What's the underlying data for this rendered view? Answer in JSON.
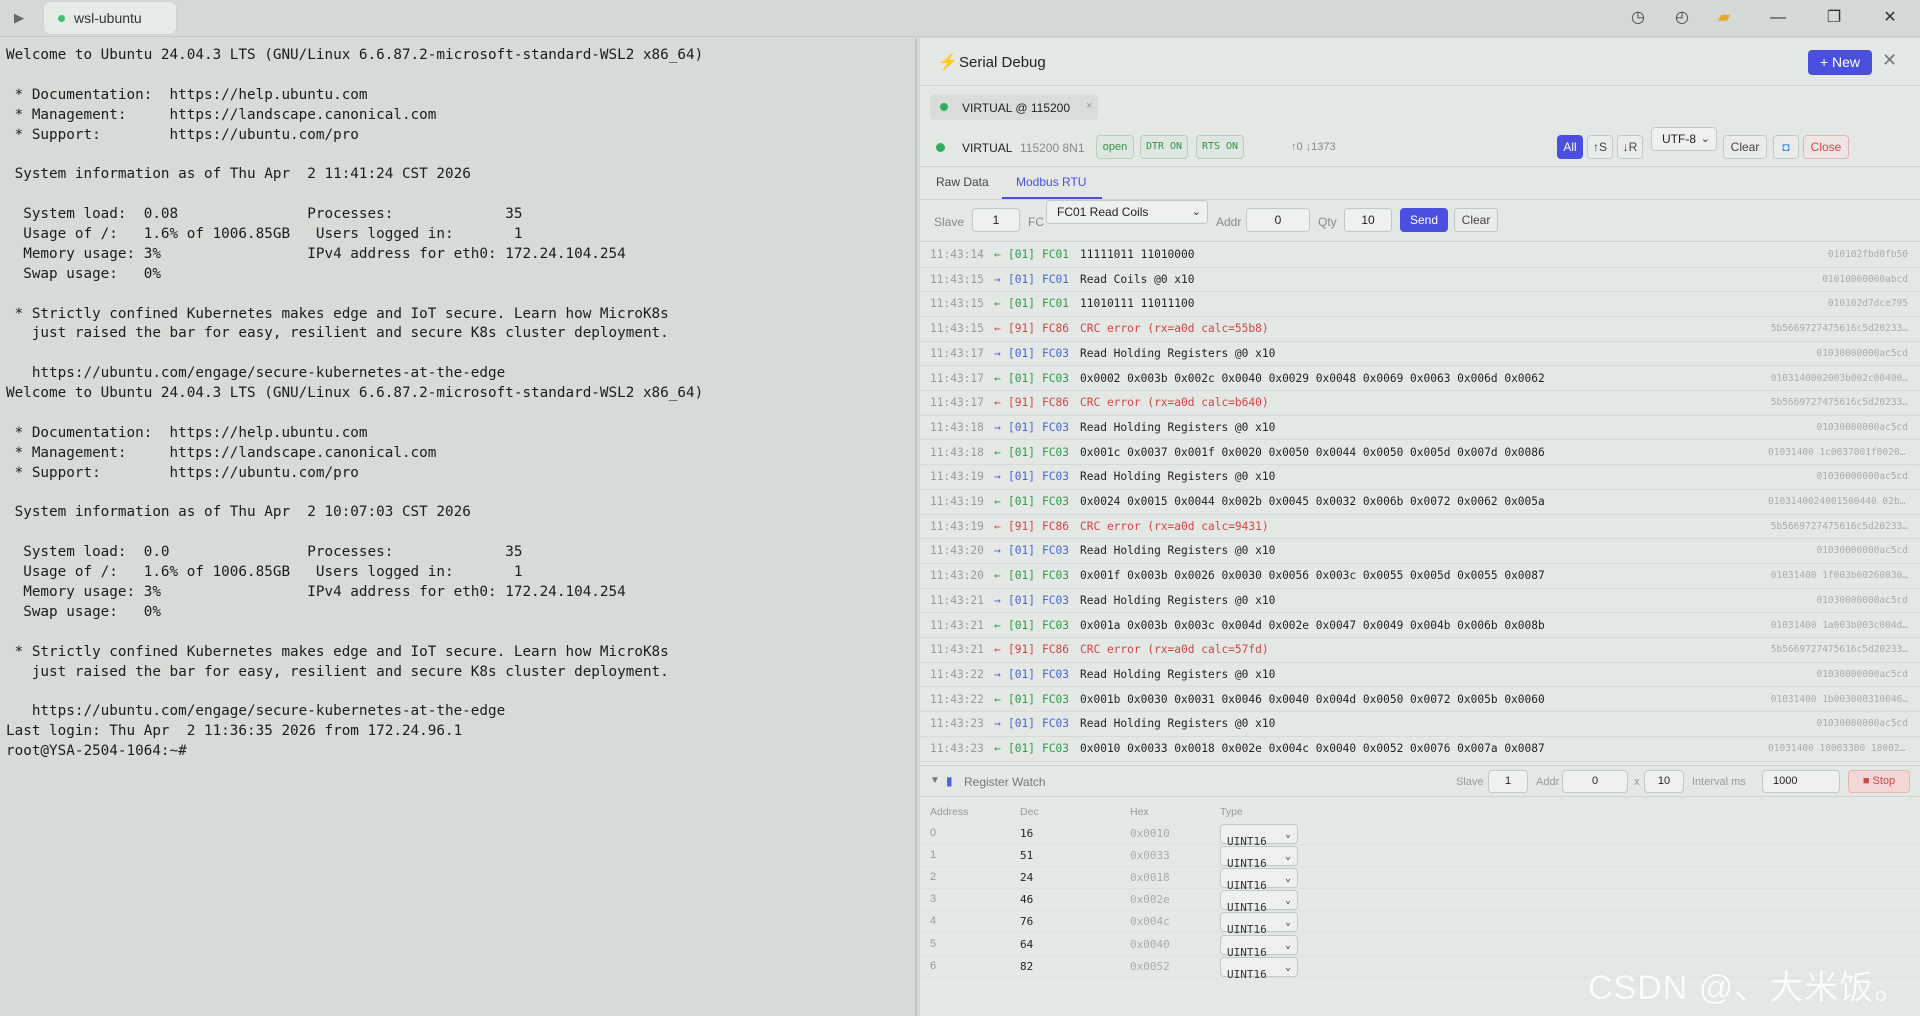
{
  "titlebar": {
    "tab_label": "wsl-ubuntu",
    "icons": [
      "play-icon",
      "history-icon",
      "clock-icon",
      "folder-icon",
      "minimize-icon",
      "restore-icon",
      "close-icon"
    ]
  },
  "terminal": {
    "lines": [
      "Welcome to Ubuntu 24.04.3 LTS (GNU/Linux 6.6.87.2-microsoft-standard-WSL2 x86_64)",
      "",
      " * Documentation:  https://help.ubuntu.com",
      " * Management:     https://landscape.canonical.com",
      " * Support:        https://ubuntu.com/pro",
      "",
      " System information as of Thu Apr  2 11:41:24 CST 2026",
      "",
      "  System load:  0.08               Processes:             35",
      "  Usage of /:   1.6% of 1006.85GB   Users logged in:       1",
      "  Memory usage: 3%                 IPv4 address for eth0: 172.24.104.254",
      "  Swap usage:   0%",
      "",
      " * Strictly confined Kubernetes makes edge and IoT secure. Learn how MicroK8s",
      "   just raised the bar for easy, resilient and secure K8s cluster deployment.",
      "",
      "   https://ubuntu.com/engage/secure-kubernetes-at-the-edge",
      "Welcome to Ubuntu 24.04.3 LTS (GNU/Linux 6.6.87.2-microsoft-standard-WSL2 x86_64)",
      "",
      " * Documentation:  https://help.ubuntu.com",
      " * Management:     https://landscape.canonical.com",
      " * Support:        https://ubuntu.com/pro",
      "",
      " System information as of Thu Apr  2 10:07:03 CST 2026",
      "",
      "  System load:  0.0                Processes:             35",
      "  Usage of /:   1.6% of 1006.85GB   Users logged in:       1",
      "  Memory usage: 3%                 IPv4 address for eth0: 172.24.104.254",
      "  Swap usage:   0%",
      "",
      " * Strictly confined Kubernetes makes edge and IoT secure. Learn how MicroK8s",
      "   just raised the bar for easy, resilient and secure K8s cluster deployment.",
      "",
      "   https://ubuntu.com/engage/secure-kubernetes-at-the-edge",
      "Last login: Thu Apr  2 11:36:35 2026 from 172.24.96.1",
      "root@YSA-2504-1064:~#"
    ]
  },
  "panel": {
    "title": "Serial Debug",
    "new_label": "+ New",
    "chip_label": "VIRTUAL @ 115200",
    "chip_close": "×",
    "status": {
      "name": "VIRTUAL",
      "baud": "115200 8N1",
      "open": "open",
      "dtr": "DTR ON",
      "rts": "RTS ON",
      "counts": "↑0 ↓1373",
      "all": "All",
      "tx_filter": "↑S",
      "rx_filter": "↓R",
      "encoding": "UTF-8",
      "clear": "Clear",
      "close": "Close"
    },
    "tabs": {
      "raw": "Raw Data",
      "modbus": "Modbus RTU"
    },
    "controls": {
      "slave_label": "Slave",
      "slave": "1",
      "fc_label": "FC",
      "fc": "FC01 Read Coils",
      "addr_label": "Addr",
      "addr": "0",
      "qty_label": "Qty",
      "qty": "10",
      "send": "Send",
      "clear": "Clear"
    },
    "log": [
      {
        "time": "11:43:14",
        "dir": "←",
        "type": "rx",
        "unit": "[01]",
        "fc": "FC01",
        "msg": "11111011 11010000",
        "raw": "010102fbd0fb50"
      },
      {
        "time": "11:43:15",
        "dir": "→",
        "type": "tx",
        "unit": "[01]",
        "fc": "FC01",
        "msg": "Read Coils @0 x10",
        "raw": "01010000000abcd"
      },
      {
        "time": "11:43:15",
        "dir": "←",
        "type": "rx",
        "unit": "[01]",
        "fc": "FC01",
        "msg": "11010111 11011100",
        "raw": "010102d7dce795"
      },
      {
        "time": "11:43:15",
        "dir": "←",
        "type": "er",
        "unit": "[91]",
        "fc": "FC86",
        "msg": "CRC error (rx=a0d calc=55b8)",
        "raw": "5b5669727475616c5d20233…"
      },
      {
        "time": "11:43:17",
        "dir": "→",
        "type": "tx",
        "unit": "[01]",
        "fc": "FC03",
        "msg": "Read Holding Registers @0 x10",
        "raw": "01030000000ac5cd"
      },
      {
        "time": "11:43:17",
        "dir": "←",
        "type": "rx",
        "unit": "[01]",
        "fc": "FC03",
        "msg": "0x0002 0x003b 0x002c 0x0040 0x0029 0x0048 0x0069 0x0063 0x006d 0x0062",
        "raw": "0103140002003b002c00400…"
      },
      {
        "time": "11:43:17",
        "dir": "←",
        "type": "er",
        "unit": "[91]",
        "fc": "FC86",
        "msg": "CRC error (rx=a0d calc=b640)",
        "raw": "5b5669727475616c5d20233…"
      },
      {
        "time": "11:43:18",
        "dir": "→",
        "type": "tx",
        "unit": "[01]",
        "fc": "FC03",
        "msg": "Read Holding Registers @0 x10",
        "raw": "01030000000ac5cd"
      },
      {
        "time": "11:43:18",
        "dir": "←",
        "type": "rx",
        "unit": "[01]",
        "fc": "FC03",
        "msg": "0x001c 0x0037 0x001f 0x0020 0x0050 0x0044 0x0050 0x005d 0x007d 0x0086",
        "raw": "01031400 1c0037001f00200…"
      },
      {
        "time": "11:43:19",
        "dir": "→",
        "type": "tx",
        "unit": "[01]",
        "fc": "FC03",
        "msg": "Read Holding Registers @0 x10",
        "raw": "01030000000ac5cd"
      },
      {
        "time": "11:43:19",
        "dir": "←",
        "type": "rx",
        "unit": "[01]",
        "fc": "FC03",
        "msg": "0x0024 0x0015 0x0044 0x002b 0x0045 0x0032 0x006b 0x0072 0x0062 0x005a",
        "raw": "0103140024001500440 02b0…"
      },
      {
        "time": "11:43:19",
        "dir": "←",
        "type": "er",
        "unit": "[91]",
        "fc": "FC86",
        "msg": "CRC error (rx=a0d calc=9431)",
        "raw": "5b5669727475616c5d20233…"
      },
      {
        "time": "11:43:20",
        "dir": "→",
        "type": "tx",
        "unit": "[01]",
        "fc": "FC03",
        "msg": "Read Holding Registers @0 x10",
        "raw": "01030000000ac5cd"
      },
      {
        "time": "11:43:20",
        "dir": "←",
        "type": "rx",
        "unit": "[01]",
        "fc": "FC03",
        "msg": "0x001f 0x003b 0x0026 0x0030 0x0056 0x003c 0x0055 0x005d 0x0055 0x0087",
        "raw": "01031400 1f003b00260030…"
      },
      {
        "time": "11:43:21",
        "dir": "→",
        "type": "tx",
        "unit": "[01]",
        "fc": "FC03",
        "msg": "Read Holding Registers @0 x10",
        "raw": "01030000000ac5cd"
      },
      {
        "time": "11:43:21",
        "dir": "←",
        "type": "rx",
        "unit": "[01]",
        "fc": "FC03",
        "msg": "0x001a 0x003b 0x003c 0x004d 0x002e 0x0047 0x0049 0x004b 0x006b 0x008b",
        "raw": "01031400 1a003b003c004d…"
      },
      {
        "time": "11:43:21",
        "dir": "←",
        "type": "er",
        "unit": "[91]",
        "fc": "FC86",
        "msg": "CRC error (rx=a0d calc=57fd)",
        "raw": "5b5669727475616c5d20233…"
      },
      {
        "time": "11:43:22",
        "dir": "→",
        "type": "tx",
        "unit": "[01]",
        "fc": "FC03",
        "msg": "Read Holding Registers @0 x10",
        "raw": "01030000000ac5cd"
      },
      {
        "time": "11:43:22",
        "dir": "←",
        "type": "rx",
        "unit": "[01]",
        "fc": "FC03",
        "msg": "0x001b 0x0030 0x0031 0x0046 0x0040 0x004d 0x0050 0x0072 0x005b 0x0060",
        "raw": "01031400 1b003000310046…"
      },
      {
        "time": "11:43:23",
        "dir": "→",
        "type": "tx",
        "unit": "[01]",
        "fc": "FC03",
        "msg": "Read Holding Registers @0 x10",
        "raw": "01030000000ac5cd"
      },
      {
        "time": "11:43:23",
        "dir": "←",
        "type": "rx",
        "unit": "[01]",
        "fc": "FC03",
        "msg": "0x0010 0x0033 0x0018 0x002e 0x004c 0x0040 0x0052 0x0076 0x007a 0x0087",
        "raw": "01031400 10003300 18002e…"
      }
    ],
    "watch": {
      "title": "Register Watch",
      "slave_label": "Slave",
      "slave": "1",
      "addr_label": "Addr",
      "addr": "0",
      "x_label": "x",
      "qty": "10",
      "interval_label": "Interval ms",
      "interval": "1000",
      "stop": "Stop",
      "headers": {
        "address": "Address",
        "dec": "Dec",
        "hex": "Hex",
        "type": "Type"
      },
      "rows": [
        {
          "address": "0",
          "dec": "16",
          "hex": "0x0010",
          "type": "UINT16"
        },
        {
          "address": "1",
          "dec": "51",
          "hex": "0x0033",
          "type": "UINT16"
        },
        {
          "address": "2",
          "dec": "24",
          "hex": "0x0018",
          "type": "UINT16"
        },
        {
          "address": "3",
          "dec": "46",
          "hex": "0x002e",
          "type": "UINT16"
        },
        {
          "address": "4",
          "dec": "76",
          "hex": "0x004c",
          "type": "UINT16"
        },
        {
          "address": "5",
          "dec": "64",
          "hex": "0x0040",
          "type": "UINT16"
        },
        {
          "address": "6",
          "dec": "82",
          "hex": "0x0052",
          "type": "UINT16"
        }
      ]
    }
  },
  "watermark": "CSDN @、大米饭。",
  "colors": {
    "accent": "#4a4fe0",
    "rx": "#2d9a4c",
    "tx": "#4a64d8",
    "error": "#d34545",
    "status_ok": "#2fb05e"
  }
}
